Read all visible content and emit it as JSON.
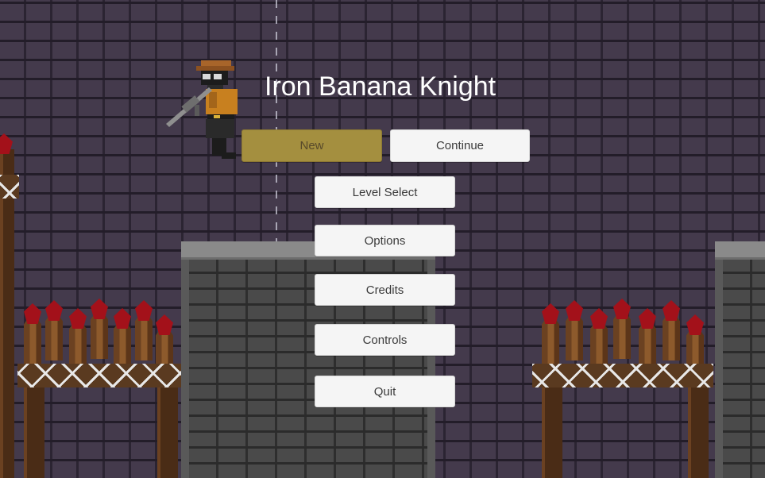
{
  "game": {
    "title": "Iron Banana Knight"
  },
  "menu": {
    "new_label": "New",
    "continue_label": "Continue",
    "level_select_label": "Level Select",
    "options_label": "Options",
    "credits_label": "Credits",
    "controls_label": "Controls",
    "quit_label": "Quit",
    "selected": "New"
  },
  "colors": {
    "selected_button": "#a48f3f",
    "button": "#f5f5f5",
    "title_text": "#ffffff",
    "brick_wall": "#3a3140"
  },
  "icons": {
    "character": "knight-with-rifle-sprite",
    "hazard": "bloody-wooden-stakes"
  }
}
